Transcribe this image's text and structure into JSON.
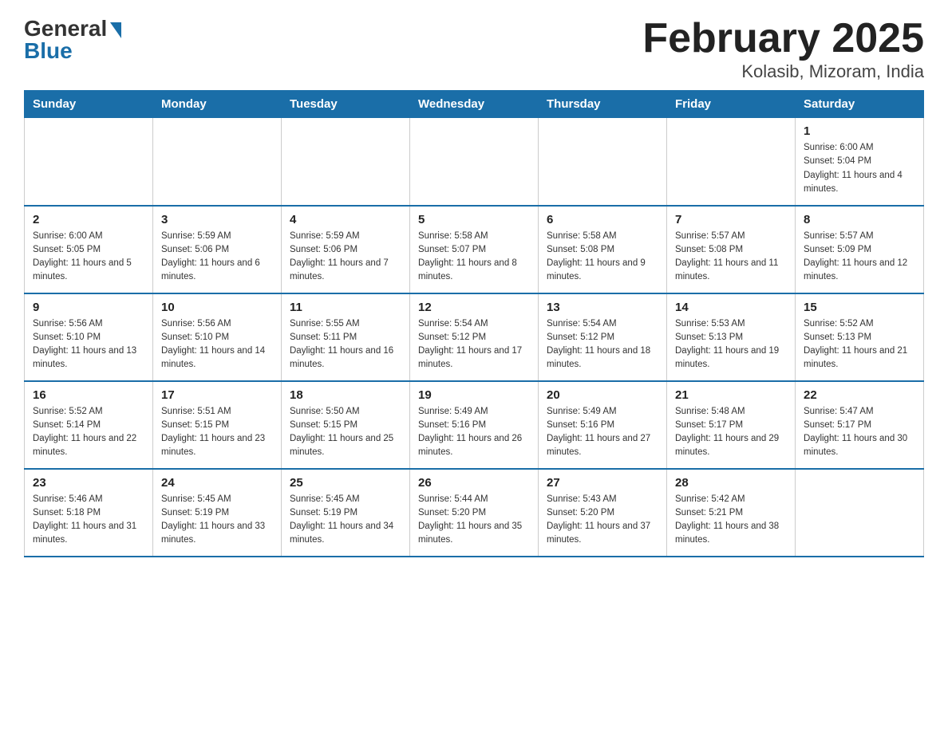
{
  "header": {
    "logo_general": "General",
    "logo_blue": "Blue",
    "title": "February 2025",
    "subtitle": "Kolasib, Mizoram, India"
  },
  "days_of_week": [
    "Sunday",
    "Monday",
    "Tuesday",
    "Wednesday",
    "Thursday",
    "Friday",
    "Saturday"
  ],
  "weeks": [
    [
      {
        "day": "",
        "info": ""
      },
      {
        "day": "",
        "info": ""
      },
      {
        "day": "",
        "info": ""
      },
      {
        "day": "",
        "info": ""
      },
      {
        "day": "",
        "info": ""
      },
      {
        "day": "",
        "info": ""
      },
      {
        "day": "1",
        "info": "Sunrise: 6:00 AM\nSunset: 5:04 PM\nDaylight: 11 hours and 4 minutes."
      }
    ],
    [
      {
        "day": "2",
        "info": "Sunrise: 6:00 AM\nSunset: 5:05 PM\nDaylight: 11 hours and 5 minutes."
      },
      {
        "day": "3",
        "info": "Sunrise: 5:59 AM\nSunset: 5:06 PM\nDaylight: 11 hours and 6 minutes."
      },
      {
        "day": "4",
        "info": "Sunrise: 5:59 AM\nSunset: 5:06 PM\nDaylight: 11 hours and 7 minutes."
      },
      {
        "day": "5",
        "info": "Sunrise: 5:58 AM\nSunset: 5:07 PM\nDaylight: 11 hours and 8 minutes."
      },
      {
        "day": "6",
        "info": "Sunrise: 5:58 AM\nSunset: 5:08 PM\nDaylight: 11 hours and 9 minutes."
      },
      {
        "day": "7",
        "info": "Sunrise: 5:57 AM\nSunset: 5:08 PM\nDaylight: 11 hours and 11 minutes."
      },
      {
        "day": "8",
        "info": "Sunrise: 5:57 AM\nSunset: 5:09 PM\nDaylight: 11 hours and 12 minutes."
      }
    ],
    [
      {
        "day": "9",
        "info": "Sunrise: 5:56 AM\nSunset: 5:10 PM\nDaylight: 11 hours and 13 minutes."
      },
      {
        "day": "10",
        "info": "Sunrise: 5:56 AM\nSunset: 5:10 PM\nDaylight: 11 hours and 14 minutes."
      },
      {
        "day": "11",
        "info": "Sunrise: 5:55 AM\nSunset: 5:11 PM\nDaylight: 11 hours and 16 minutes."
      },
      {
        "day": "12",
        "info": "Sunrise: 5:54 AM\nSunset: 5:12 PM\nDaylight: 11 hours and 17 minutes."
      },
      {
        "day": "13",
        "info": "Sunrise: 5:54 AM\nSunset: 5:12 PM\nDaylight: 11 hours and 18 minutes."
      },
      {
        "day": "14",
        "info": "Sunrise: 5:53 AM\nSunset: 5:13 PM\nDaylight: 11 hours and 19 minutes."
      },
      {
        "day": "15",
        "info": "Sunrise: 5:52 AM\nSunset: 5:13 PM\nDaylight: 11 hours and 21 minutes."
      }
    ],
    [
      {
        "day": "16",
        "info": "Sunrise: 5:52 AM\nSunset: 5:14 PM\nDaylight: 11 hours and 22 minutes."
      },
      {
        "day": "17",
        "info": "Sunrise: 5:51 AM\nSunset: 5:15 PM\nDaylight: 11 hours and 23 minutes."
      },
      {
        "day": "18",
        "info": "Sunrise: 5:50 AM\nSunset: 5:15 PM\nDaylight: 11 hours and 25 minutes."
      },
      {
        "day": "19",
        "info": "Sunrise: 5:49 AM\nSunset: 5:16 PM\nDaylight: 11 hours and 26 minutes."
      },
      {
        "day": "20",
        "info": "Sunrise: 5:49 AM\nSunset: 5:16 PM\nDaylight: 11 hours and 27 minutes."
      },
      {
        "day": "21",
        "info": "Sunrise: 5:48 AM\nSunset: 5:17 PM\nDaylight: 11 hours and 29 minutes."
      },
      {
        "day": "22",
        "info": "Sunrise: 5:47 AM\nSunset: 5:17 PM\nDaylight: 11 hours and 30 minutes."
      }
    ],
    [
      {
        "day": "23",
        "info": "Sunrise: 5:46 AM\nSunset: 5:18 PM\nDaylight: 11 hours and 31 minutes."
      },
      {
        "day": "24",
        "info": "Sunrise: 5:45 AM\nSunset: 5:19 PM\nDaylight: 11 hours and 33 minutes."
      },
      {
        "day": "25",
        "info": "Sunrise: 5:45 AM\nSunset: 5:19 PM\nDaylight: 11 hours and 34 minutes."
      },
      {
        "day": "26",
        "info": "Sunrise: 5:44 AM\nSunset: 5:20 PM\nDaylight: 11 hours and 35 minutes."
      },
      {
        "day": "27",
        "info": "Sunrise: 5:43 AM\nSunset: 5:20 PM\nDaylight: 11 hours and 37 minutes."
      },
      {
        "day": "28",
        "info": "Sunrise: 5:42 AM\nSunset: 5:21 PM\nDaylight: 11 hours and 38 minutes."
      },
      {
        "day": "",
        "info": ""
      }
    ]
  ]
}
